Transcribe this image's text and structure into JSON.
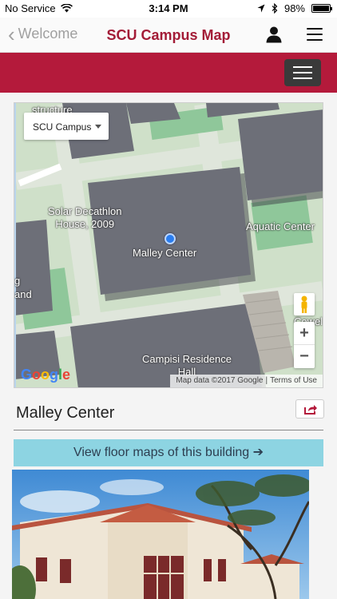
{
  "status_bar": {
    "carrier": "No Service",
    "time": "3:14 PM",
    "battery": "98%",
    "battery_level": 0.98
  },
  "nav": {
    "back_label": "Welcome",
    "title": "SCU Campus Map"
  },
  "map": {
    "campus_select": "SCU Campus",
    "labels": {
      "top_left": "structure",
      "solar": "Solar Decathlon\nHouse, 2009",
      "malley": "Malley Center",
      "aquatic": "Aquatic Center",
      "campisi": "Campisi Residence\nHall",
      "cowell": "Cowel",
      "left_g": "g",
      "left_and": "and"
    },
    "zoom_in": "+",
    "zoom_out": "−",
    "attribution": "Map data ©2017 Google",
    "terms": "Terms of Use",
    "google_logo": "Google"
  },
  "building": {
    "name": "Malley Center",
    "floor_maps_label": "View floor maps of this building ➔"
  },
  "colors": {
    "brand_red": "#b41a3b",
    "title_red": "#a31c37",
    "floor_button": "#8dd4e2"
  }
}
